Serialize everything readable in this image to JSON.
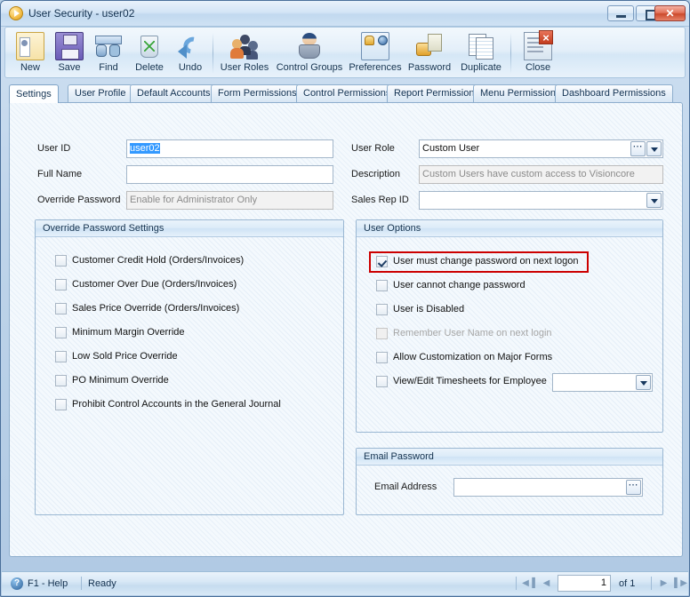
{
  "window": {
    "title": "User Security - user02",
    "icon": "app-play-icon",
    "controls": {
      "minimize": "–",
      "maximize": "□",
      "close": "✕"
    }
  },
  "toolbar": {
    "buttons": [
      {
        "label": "New",
        "icon": "new-record-icon"
      },
      {
        "label": "Save",
        "icon": "save-floppy-icon"
      },
      {
        "label": "Find",
        "icon": "find-binoculars-icon"
      },
      {
        "label": "Delete",
        "icon": "delete-recycle-bin-icon"
      },
      {
        "label": "Undo",
        "icon": "undo-arrow-icon"
      },
      {
        "label": "User Roles",
        "icon": "user-roles-icon"
      },
      {
        "label": "Control Groups",
        "icon": "control-groups-icon"
      },
      {
        "label": "Preferences",
        "icon": "preferences-icon"
      },
      {
        "label": "Password",
        "icon": "password-lock-icon"
      },
      {
        "label": "Duplicate",
        "icon": "duplicate-pages-icon"
      },
      {
        "label": "Close",
        "icon": "close-window-icon"
      }
    ]
  },
  "tabs": [
    {
      "label": "Settings",
      "active": true
    },
    {
      "label": "User Profile",
      "active": false
    },
    {
      "label": "Default Accounts",
      "active": false
    },
    {
      "label": "Form Permissions",
      "active": false
    },
    {
      "label": "Control Permissions",
      "active": false
    },
    {
      "label": "Report Permissions",
      "active": false
    },
    {
      "label": "Menu Permissions",
      "active": false
    },
    {
      "label": "Dashboard Permissions",
      "active": false
    }
  ],
  "form": {
    "left": {
      "user_id_label": "User ID",
      "user_id_value": "user02",
      "full_name_label": "Full Name",
      "full_name_value": "",
      "override_password_label": "Override Password",
      "override_password_placeholder": "Enable for Administrator Only"
    },
    "right": {
      "user_role_label": "User Role",
      "user_role_value": "Custom User",
      "description_label": "Description",
      "description_value": "Custom Users have custom access to Visioncore",
      "sales_rep_label": "Sales Rep ID",
      "sales_rep_value": ""
    }
  },
  "override_password_settings": {
    "title": "Override Password Settings",
    "items": [
      {
        "label": "Customer Credit Hold (Orders/Invoices)",
        "checked": false,
        "disabled": false
      },
      {
        "label": "Customer Over Due (Orders/Invoices)",
        "checked": false,
        "disabled": false
      },
      {
        "label": "Sales Price Override (Orders/Invoices)",
        "checked": false,
        "disabled": false
      },
      {
        "label": "Minimum Margin Override",
        "checked": false,
        "disabled": false
      },
      {
        "label": "Low Sold Price Override",
        "checked": false,
        "disabled": false
      },
      {
        "label": "PO Minimum Override",
        "checked": false,
        "disabled": false
      },
      {
        "label": "Prohibit Control Accounts in the General Journal",
        "checked": false,
        "disabled": false
      }
    ]
  },
  "user_options": {
    "title": "User Options",
    "highlight_color": "#cc0000",
    "items": [
      {
        "label": "User must change password on next logon",
        "checked": true,
        "disabled": false,
        "highlighted": true
      },
      {
        "label": "User cannot change password",
        "checked": false,
        "disabled": false,
        "highlighted": false
      },
      {
        "label": "User is Disabled",
        "checked": false,
        "disabled": false,
        "highlighted": false
      },
      {
        "label": "Remember User Name on next login",
        "checked": false,
        "disabled": true,
        "highlighted": false
      },
      {
        "label": "Allow Customization on Major Forms",
        "checked": false,
        "disabled": false,
        "highlighted": false
      },
      {
        "label": "View/Edit Timesheets for Employee",
        "checked": false,
        "disabled": false,
        "highlighted": false
      }
    ],
    "timesheet_employee_value": ""
  },
  "email_password": {
    "title": "Email Password",
    "email_label": "Email Address",
    "email_value": "",
    "browse_button": "…"
  },
  "statusbar": {
    "help_icon": "help-question-icon",
    "help_text": "F1 - Help",
    "status_text": "Ready",
    "record_current": "1",
    "record_of": "of 1",
    "nav": {
      "first": "◀▐",
      "prev": "◀",
      "next": "▶",
      "last": "▌▶"
    }
  }
}
